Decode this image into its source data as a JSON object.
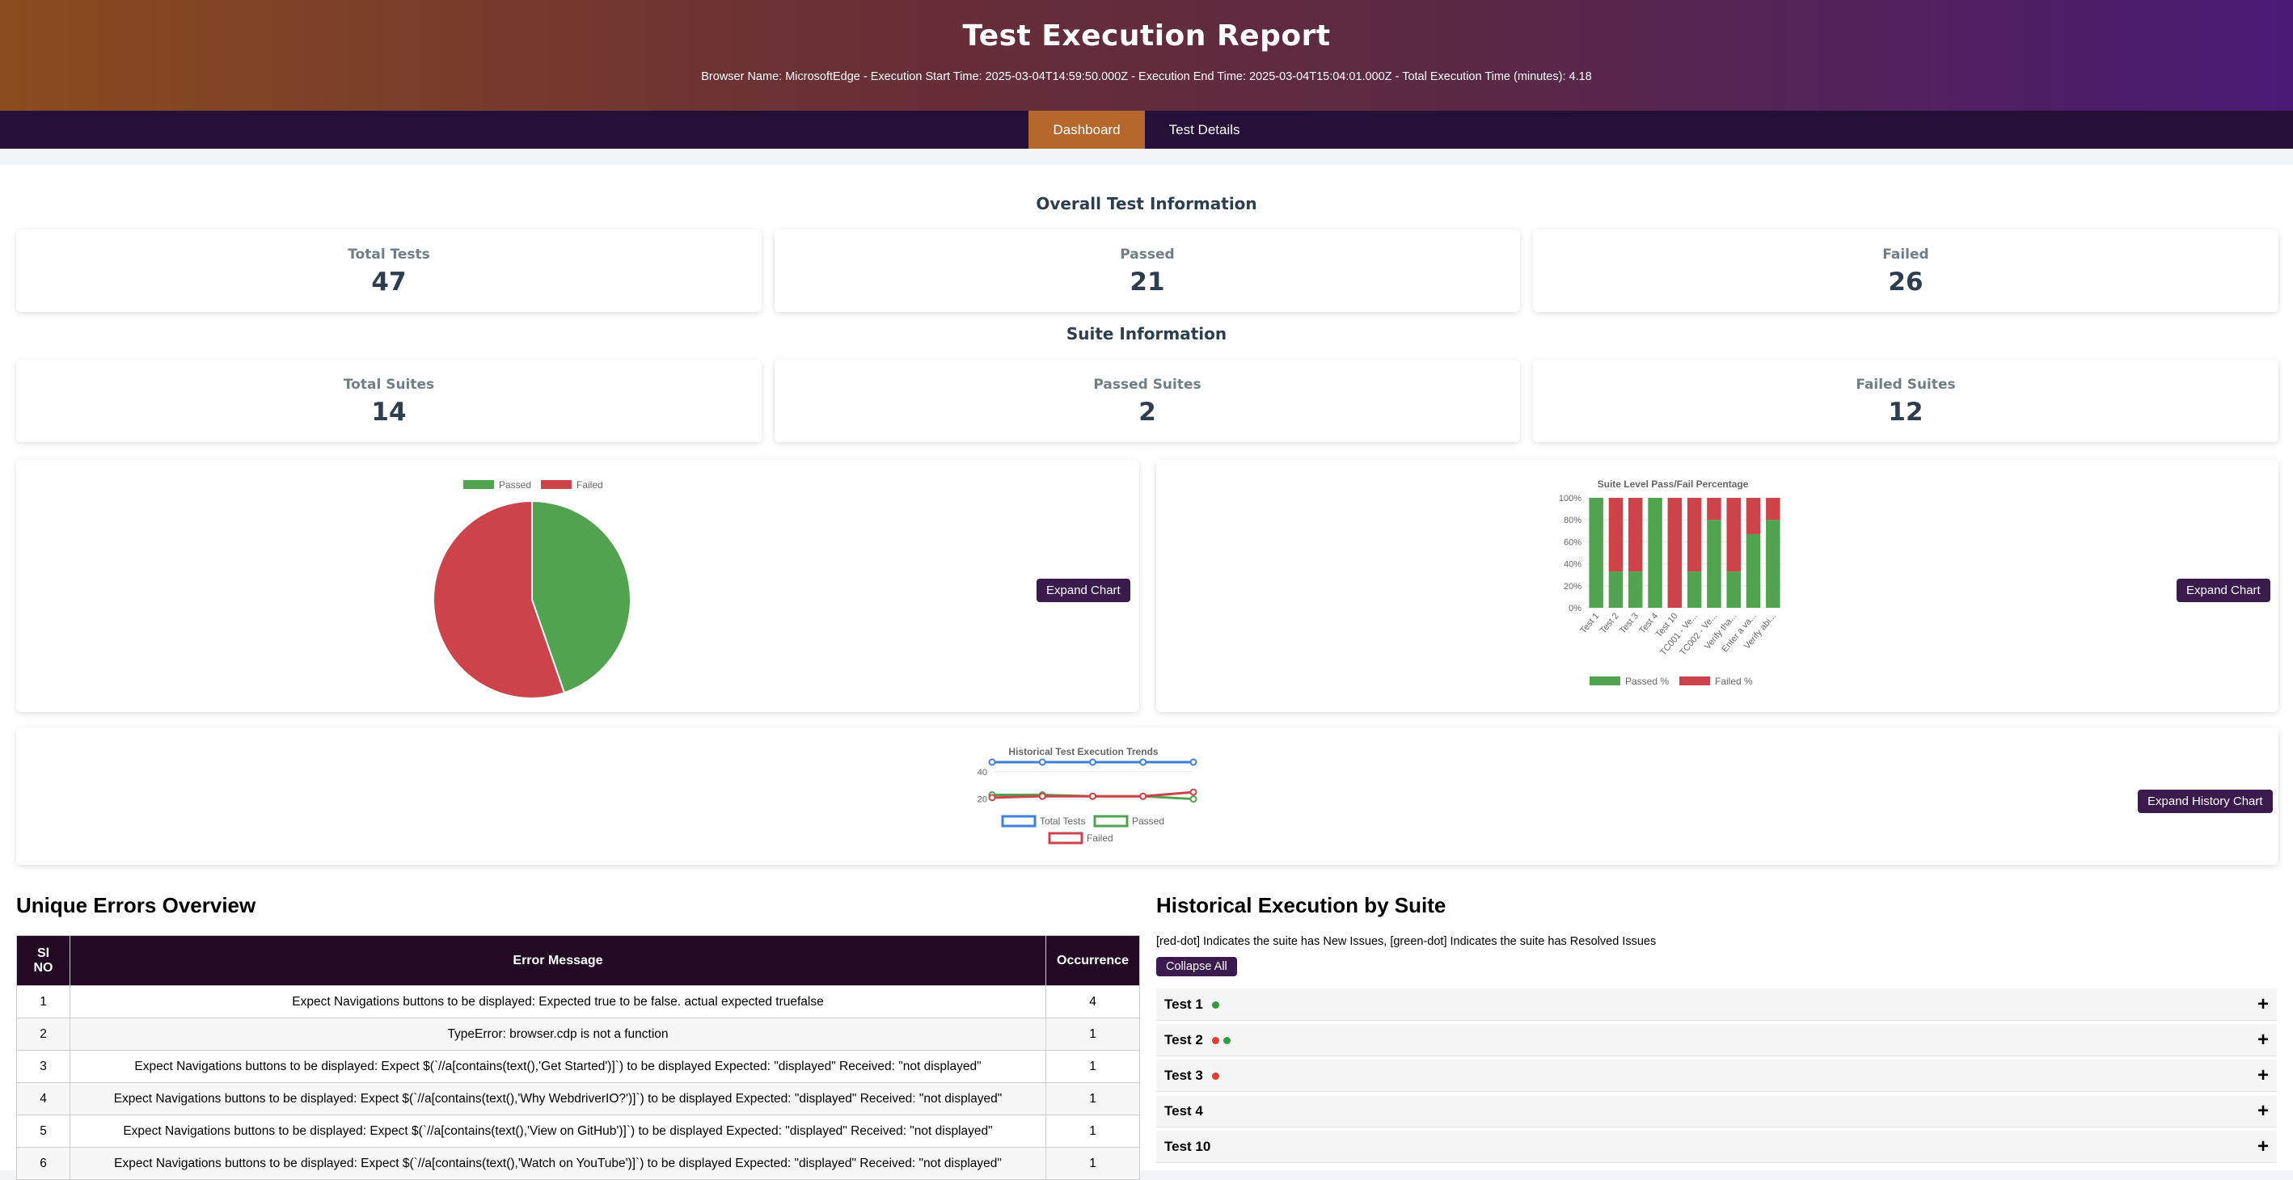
{
  "header": {
    "title": "Test Execution Report",
    "meta": "Browser Name: MicrosoftEdge - Execution Start Time: 2025-03-04T14:59:50.000Z - Execution End Time: 2025-03-04T15:04:01.000Z - Total Execution Time (minutes): 4.18"
  },
  "nav": {
    "tabs": [
      "Dashboard",
      "Test Details"
    ],
    "active": "Dashboard"
  },
  "overall": {
    "title": "Overall Test Information",
    "total_label": "Total Tests",
    "total": "47",
    "passed_label": "Passed",
    "passed": "21",
    "failed_label": "Failed",
    "failed": "26"
  },
  "suites": {
    "title": "Suite Information",
    "total_label": "Total Suites",
    "total": "14",
    "passed_label": "Passed Suites",
    "passed": "2",
    "failed_label": "Failed Suites",
    "failed": "12"
  },
  "buttons": {
    "expand_chart": "Expand Chart",
    "expand_history": "Expand History Chart",
    "collapse_all": "Collapse All"
  },
  "colors": {
    "passed": "#52a34f",
    "failed": "#cc4449",
    "total": "#3f7fdc",
    "accent": "#b5672c",
    "nav": "#251038"
  },
  "chart_data": [
    {
      "type": "pie",
      "legend": [
        "Passed",
        "Failed"
      ],
      "values": [
        21,
        26
      ]
    },
    {
      "type": "bar",
      "title": "Suite Level Pass/Fail Percentage",
      "categories": [
        "Test 1",
        "Test 2",
        "Test 3",
        "Test 4",
        "Test 10",
        "TC001 - Ve...",
        "TC002 - Ve...",
        "Verify tha...",
        "Enter a va...",
        "Verify abi..."
      ],
      "series": [
        {
          "name": "Passed %",
          "values": [
            100,
            33,
            33,
            100,
            0,
            33,
            80,
            33,
            67,
            80
          ]
        },
        {
          "name": "Failed %",
          "values": [
            0,
            67,
            67,
            0,
            100,
            67,
            20,
            67,
            33,
            20
          ]
        }
      ],
      "stacked": true,
      "yticks": [
        "0%",
        "20%",
        "40%",
        "60%",
        "80%",
        "100%"
      ],
      "ylim": [
        0,
        100
      ]
    },
    {
      "type": "line",
      "title": "Historical Test Execution Trends",
      "x": [
        1,
        2,
        3,
        4,
        5
      ],
      "yticks": [
        "20",
        "40"
      ],
      "ylim": [
        15,
        47
      ],
      "series": [
        {
          "name": "Total Tests",
          "values": [
            47,
            47,
            47,
            47,
            47
          ]
        },
        {
          "name": "Passed",
          "values": [
            23,
            23,
            22,
            22,
            20
          ]
        },
        {
          "name": "Failed",
          "values": [
            21,
            22,
            22,
            22,
            25
          ]
        }
      ]
    }
  ],
  "errors": {
    "title": "Unique Errors Overview",
    "columns": [
      "Sl NO",
      "Error Message",
      "Occurrence"
    ],
    "rows": [
      {
        "no": "1",
        "msg": "Expect Navigations buttons to be displayed: Expected true to be false. actual expected truefalse",
        "count": "4"
      },
      {
        "no": "2",
        "msg": "TypeError: browser.cdp is not a function",
        "count": "1"
      },
      {
        "no": "3",
        "msg": "Expect Navigations buttons to be displayed: Expect $(`//a[contains(text(),'Get Started')]`) to be displayed Expected: \"displayed\" Received: \"not displayed\"",
        "count": "1"
      },
      {
        "no": "4",
        "msg": "Expect Navigations buttons to be displayed: Expect $(`//a[contains(text(),'Why WebdriverIO?')]`) to be displayed Expected: \"displayed\" Received: \"not displayed\"",
        "count": "1"
      },
      {
        "no": "5",
        "msg": "Expect Navigations buttons to be displayed: Expect $(`//a[contains(text(),'View on GitHub')]`) to be displayed Expected: \"displayed\" Received: \"not displayed\"",
        "count": "1"
      },
      {
        "no": "6",
        "msg": "Expect Navigations buttons to be displayed: Expect $(`//a[contains(text(),'Watch on YouTube')]`) to be displayed Expected: \"displayed\" Received: \"not displayed\"",
        "count": "1"
      }
    ]
  },
  "history": {
    "title": "Historical Execution by Suite",
    "note": "[red-dot] Indicates the suite has New Issues, [green-dot] Indicates the suite has Resolved Issues",
    "suites": [
      {
        "name": "Test 1",
        "dots": [
          "green"
        ]
      },
      {
        "name": "Test 2",
        "dots": [
          "red",
          "green"
        ]
      },
      {
        "name": "Test 3",
        "dots": [
          "red"
        ]
      },
      {
        "name": "Test 4",
        "dots": []
      },
      {
        "name": "Test 10",
        "dots": []
      }
    ],
    "expand_symbol": "+"
  }
}
